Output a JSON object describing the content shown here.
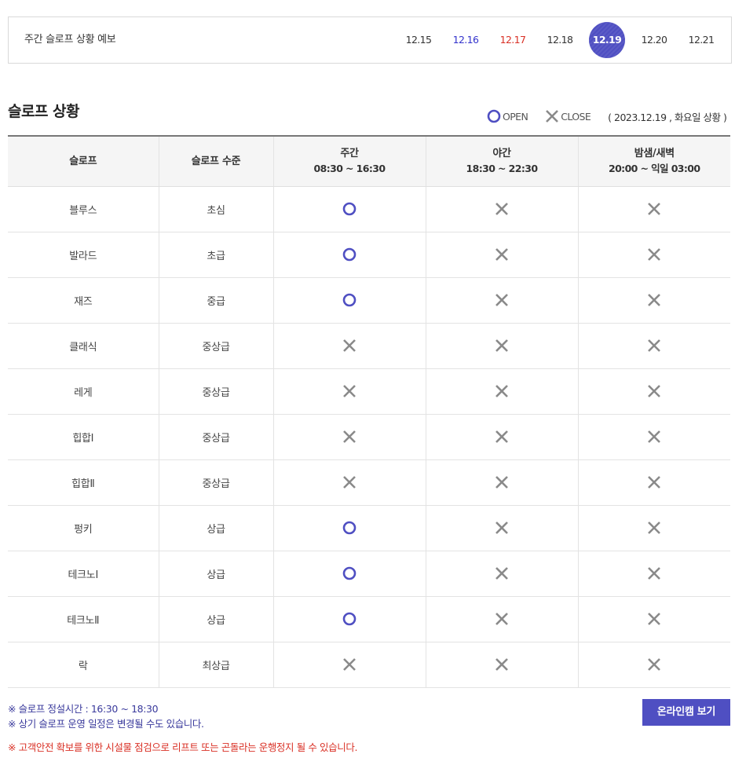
{
  "forecast": {
    "title": "주간 슬로프 상황 예보",
    "dates": [
      {
        "label": "12.15",
        "kind": "weekday",
        "active": false
      },
      {
        "label": "12.16",
        "kind": "sat",
        "active": false
      },
      {
        "label": "12.17",
        "kind": "sun",
        "active": false
      },
      {
        "label": "12.18",
        "kind": "weekday",
        "active": false
      },
      {
        "label": "12.19",
        "kind": "weekday",
        "active": true
      },
      {
        "label": "12.20",
        "kind": "weekday",
        "active": false
      },
      {
        "label": "12.21",
        "kind": "weekday",
        "active": false
      }
    ]
  },
  "section": {
    "title": "슬로프 상황",
    "legend_open": "OPEN",
    "legend_close": "CLOSE",
    "status_date": "( 2023.12.19 , 화요일 상황 )"
  },
  "table": {
    "headers": [
      {
        "label": "슬로프",
        "sub": ""
      },
      {
        "label": "슬로프 수준",
        "sub": ""
      },
      {
        "label": "주간",
        "sub": "08:30 ~ 16:30"
      },
      {
        "label": "야간",
        "sub": "18:30 ~ 22:30"
      },
      {
        "label": "밤샘/새벽",
        "sub": "20:00 ~ 익일 03:00"
      }
    ],
    "rows": [
      {
        "slope": "블루스",
        "level": "초심",
        "day": "open",
        "night": "close",
        "overnight": "close"
      },
      {
        "slope": "발라드",
        "level": "초급",
        "day": "open",
        "night": "close",
        "overnight": "close"
      },
      {
        "slope": "재즈",
        "level": "중급",
        "day": "open",
        "night": "close",
        "overnight": "close"
      },
      {
        "slope": "클래식",
        "level": "중상급",
        "day": "close",
        "night": "close",
        "overnight": "close"
      },
      {
        "slope": "레게",
        "level": "중상급",
        "day": "close",
        "night": "close",
        "overnight": "close"
      },
      {
        "slope": "힙합Ⅰ",
        "level": "중상급",
        "day": "close",
        "night": "close",
        "overnight": "close"
      },
      {
        "slope": "힙합Ⅱ",
        "level": "중상급",
        "day": "close",
        "night": "close",
        "overnight": "close"
      },
      {
        "slope": "펑키",
        "level": "상급",
        "day": "open",
        "night": "close",
        "overnight": "close"
      },
      {
        "slope": "테크노Ⅰ",
        "level": "상급",
        "day": "open",
        "night": "close",
        "overnight": "close"
      },
      {
        "slope": "테크노Ⅱ",
        "level": "상급",
        "day": "open",
        "night": "close",
        "overnight": "close"
      },
      {
        "slope": "락",
        "level": "최상급",
        "day": "close",
        "night": "close",
        "overnight": "close"
      }
    ]
  },
  "notes": {
    "line1": "※ 슬로프 정설시간 : 16:30 ~ 18:30",
    "line2": "※ 상기 슬로프 운영 일정은 변경될 수도 있습니다.",
    "line3": "※ 고객안전 확보를 위한 시설물 점검으로 리프트 또는 곤돌라는 운행정지 될 수 있습니다."
  },
  "webcam_button": "온라인캠 보기",
  "colors": {
    "accent": "#4f4fc2",
    "open_icon": "#4f4fc2",
    "close_icon": "#8a8a8a",
    "saturday": "#3333cc",
    "sunday": "#d93025",
    "notice_red": "#d93025"
  }
}
